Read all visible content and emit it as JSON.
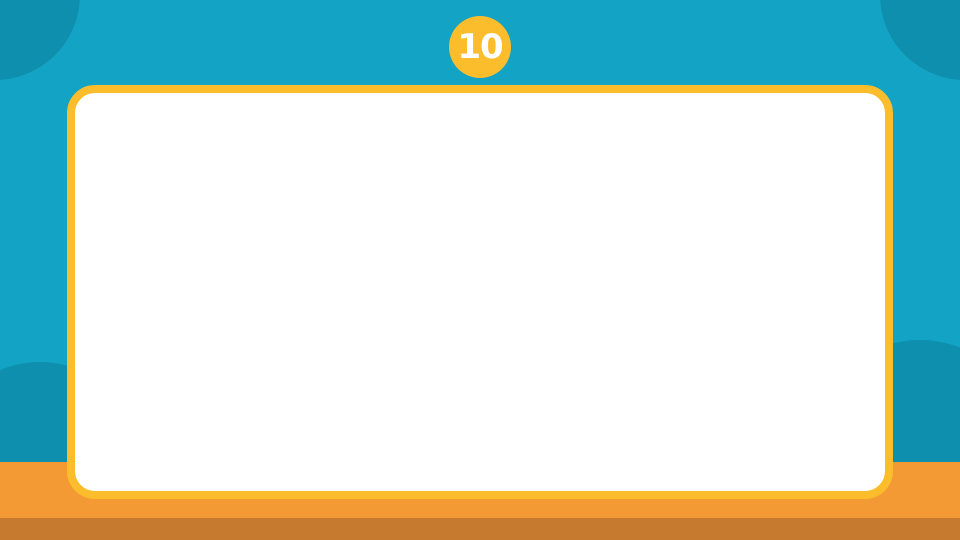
{
  "slide": {
    "number_badge": "10"
  },
  "colors": {
    "background": "#13a3c4",
    "background_shape": "#0f8fae",
    "board_border": "#fbbd2c",
    "board_fill": "#ffffff",
    "floor": "#f49a35",
    "floor_edge": "#c67a30",
    "badge": "#fbbd2c"
  }
}
